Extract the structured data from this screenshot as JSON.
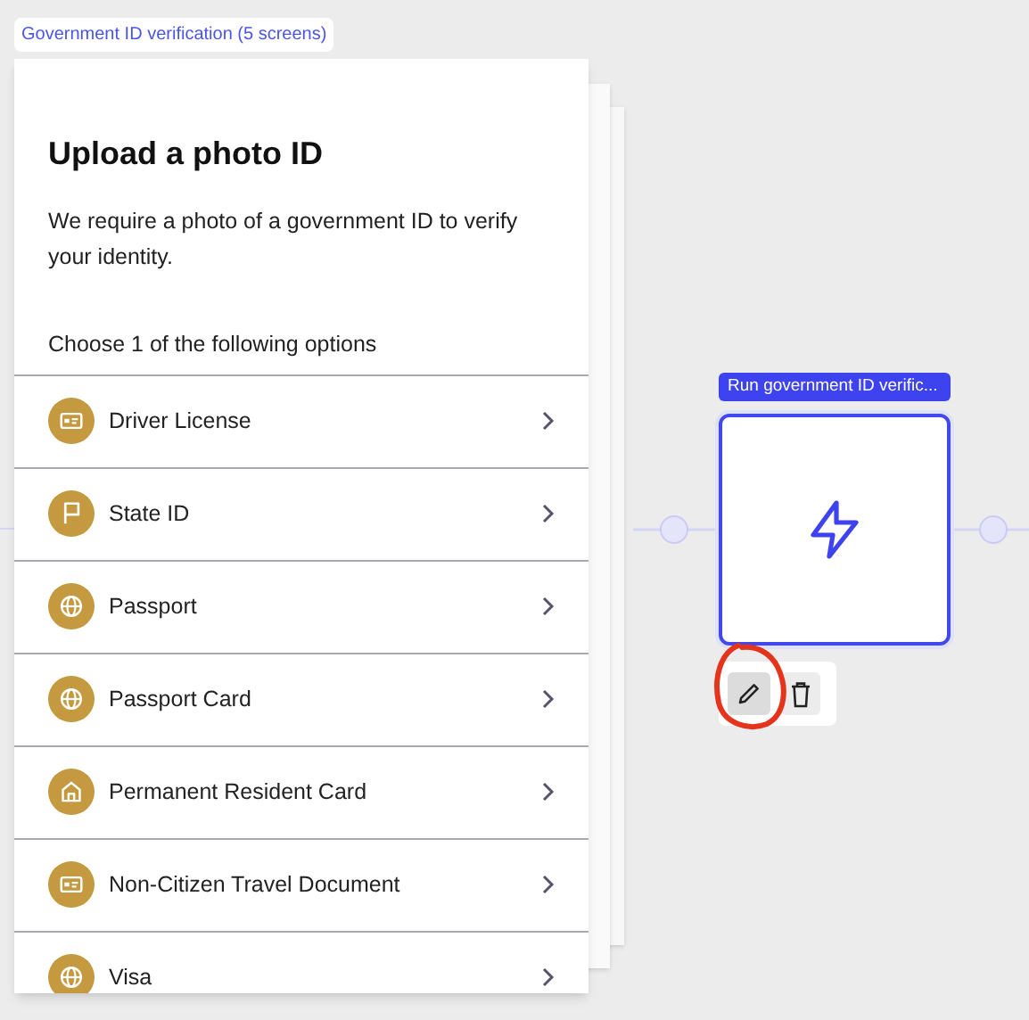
{
  "group_label": "Government ID verification (5 screens)",
  "screen": {
    "title": "Upload a photo ID",
    "description": "We require a photo of a government ID to verify your identity.",
    "prompt": "Choose 1 of the following options",
    "options": [
      {
        "label": "Driver License",
        "kind": "card"
      },
      {
        "label": "State ID",
        "kind": "flag"
      },
      {
        "label": "Passport",
        "kind": "globe"
      },
      {
        "label": "Passport Card",
        "kind": "globe"
      },
      {
        "label": "Permanent Resident Card",
        "kind": "home"
      },
      {
        "label": "Non-Citizen Travel Document",
        "kind": "card"
      },
      {
        "label": "Visa",
        "kind": "globe"
      }
    ]
  },
  "node": {
    "label": "Run government ID verific..."
  }
}
